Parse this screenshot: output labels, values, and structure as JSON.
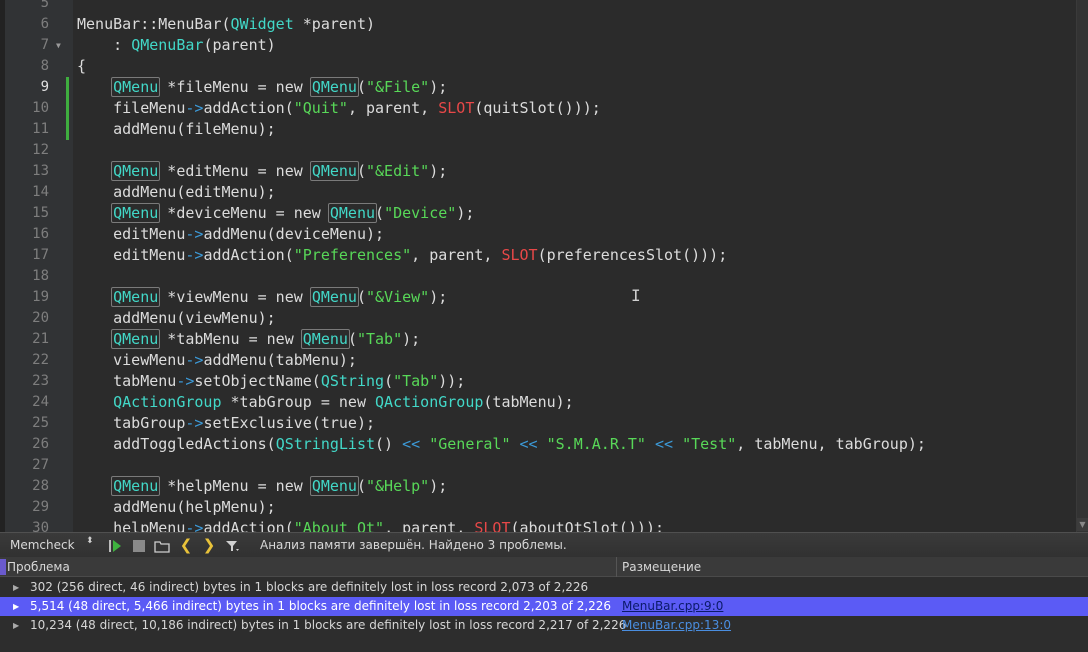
{
  "colors": {
    "editor_bg": "#2b2b2b",
    "type": "#42d8c8",
    "string": "#58d858",
    "macro": "#e84848",
    "operator": "#3c9ad8",
    "selection": "#5b5bf5",
    "link": "#4a8ee0"
  },
  "editor": {
    "current_line": 9,
    "lines": [
      {
        "n": "5",
        "code": ""
      },
      {
        "n": "6",
        "code": "MenuBar::MenuBar({t:QWidget} *parent)"
      },
      {
        "n": "7",
        "code": "    : {t:QMenuBar}(parent)",
        "fold": "▼"
      },
      {
        "n": "8",
        "code": "{"
      },
      {
        "n": "9",
        "code": "    {tb:QMenu} *fileMenu = new {tb:QMenu}({s:\"&File\"});"
      },
      {
        "n": "10",
        "code": "    fileMenu{o:->}addAction({s:\"Quit\"}, parent, {m:SLOT}(quitSlot()));"
      },
      {
        "n": "11",
        "code": "    addMenu(fileMenu);"
      },
      {
        "n": "12",
        "code": ""
      },
      {
        "n": "13",
        "code": "    {tb:QMenu} *editMenu = new {tb:QMenu}({s:\"&Edit\"});"
      },
      {
        "n": "14",
        "code": "    addMenu(editMenu);"
      },
      {
        "n": "15",
        "code": "    {tb:QMenu} *deviceMenu = new {tb:QMenu}({s:\"Device\"});"
      },
      {
        "n": "16",
        "code": "    editMenu{o:->}addMenu(deviceMenu);"
      },
      {
        "n": "17",
        "code": "    editMenu{o:->}addAction({s:\"Preferences\"}, parent, {m:SLOT}(preferencesSlot()));"
      },
      {
        "n": "18",
        "code": ""
      },
      {
        "n": "19",
        "code": "    {tb:QMenu} *viewMenu = new {tb:QMenu}({s:\"&View\"});"
      },
      {
        "n": "20",
        "code": "    addMenu(viewMenu);"
      },
      {
        "n": "21",
        "code": "    {tb:QMenu} *tabMenu = new {tb:QMenu}({s:\"Tab\"});"
      },
      {
        "n": "22",
        "code": "    viewMenu{o:->}addMenu(tabMenu);"
      },
      {
        "n": "23",
        "code": "    tabMenu{o:->}setObjectName({t:QString}({s:\"Tab\"}));"
      },
      {
        "n": "24",
        "code": "    {t:QActionGroup} *tabGroup = new {t:QActionGroup}(tabMenu);"
      },
      {
        "n": "25",
        "code": "    tabGroup{o:->}setExclusive(true);"
      },
      {
        "n": "26",
        "code": "    addToggledActions({t:QStringList}() {o:<<} {s:\"General\"} {o:<<} {s:\"S.M.A.R.T\"} {o:<<} {s:\"Test\"}, tabMenu, tabGroup);"
      },
      {
        "n": "27",
        "code": ""
      },
      {
        "n": "28",
        "code": "    {tb:QMenu} *helpMenu = new {tb:QMenu}({s:\"&Help\"});"
      },
      {
        "n": "29",
        "code": "    addMenu(helpMenu);"
      },
      {
        "n": "30",
        "code": "    helpMenu{o:->}addAction({s:\"About Qt\"}, parent, {m:SLOT}(aboutQtSlot()));"
      }
    ]
  },
  "toolbar": {
    "tool": "Memcheck",
    "select_arrows": "⬍",
    "start_icon": "▶",
    "stop_icon": "■",
    "open_icon": "📂",
    "prev_icon": "❮",
    "next_icon": "❯",
    "filter_icon": "⏷",
    "status": "Анализ памяти завершён. Найдено 3 проблемы."
  },
  "results": {
    "columns": {
      "problem": "Проблема",
      "location": "Размещение"
    },
    "rows": [
      {
        "text": "302 (256 direct, 46 indirect) bytes in 1 blocks are definitely lost in loss record 2,073 of 2,226",
        "location": "",
        "selected": false
      },
      {
        "text": "5,514 (48 direct, 5,466 indirect) bytes in 1 blocks are definitely lost in loss record 2,203 of 2,226",
        "location": "MenuBar.cpp:9:0",
        "selected": true
      },
      {
        "text": "10,234 (48 direct, 10,186 indirect) bytes in 1 blocks are definitely lost in loss record 2,217 of 2,226",
        "location": "MenuBar.cpp:13:0",
        "selected": false
      }
    ]
  }
}
